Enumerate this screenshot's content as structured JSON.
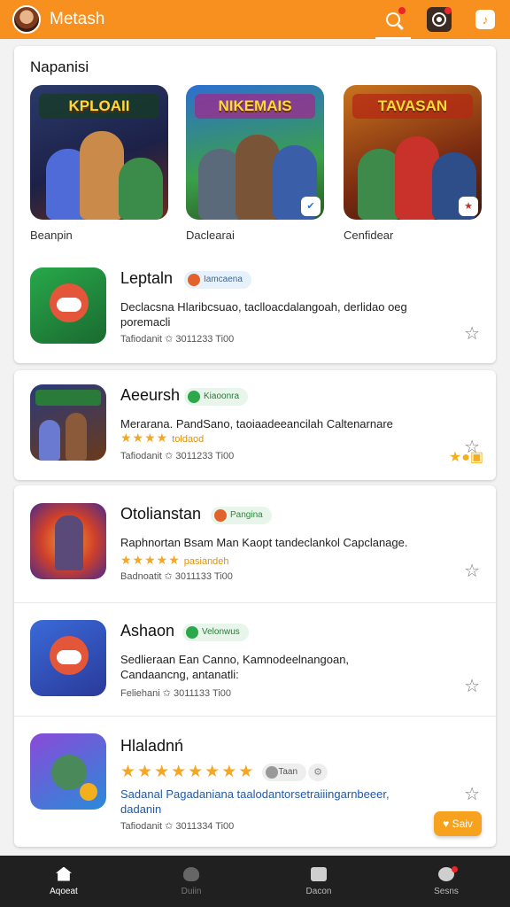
{
  "header": {
    "title": "Mеtаsh",
    "accent": "#f7901e"
  },
  "featured": {
    "section_title": "Napanisi",
    "items": [
      {
        "banner": "KPLOAII",
        "label": "Beanpin"
      },
      {
        "banner": "NIKEMAIS",
        "label": "Daclearai"
      },
      {
        "banner": "TAVASAN",
        "label": "Cenfidear"
      }
    ]
  },
  "apps": [
    {
      "title": "Leptaln",
      "tag": "Iamcaena",
      "desc": "Declacsna Hlaribcsuao, taclloacdalangoah, derlidao oeg poremacli",
      "rating_label": "",
      "meta": "Tafiodanit   ✩ 3011233 Ti00",
      "tag_color": "#e2622b"
    },
    {
      "title": "Aeeursh",
      "tag": "Kiaoonra",
      "desc": "Merarana. PandSano, taoiaadeeancilah Caltenarnare",
      "rating_label": "toldaod",
      "meta": "Tafiodanit   ✩ 3011233 Ti00",
      "tag_color": "#2aa84a"
    },
    {
      "title": "Otolianstan",
      "tag": "Pangina",
      "desc": "Raphnortan Bsam Man Kaopt tandeclankol Capclanage.",
      "rating_label": "pasiandeh",
      "meta": "Badnoatit   ✩ 3011133 Ti00",
      "tag_color": "#e2622b"
    },
    {
      "title": "Ashaon",
      "tag": "Velonwus",
      "desc": "Sedlieraan Ean Canno, Kamnodeelnangoan, Candaancng, antanatli:",
      "rating_label": "",
      "meta": "Feliehani   ✩ 3011133 Ti00",
      "tag_color": "#2aa84a"
    },
    {
      "title": "Hlaladnń",
      "tag": "3.Taan",
      "desc": "Sadanal Pagadaniana taalodantorsetraiiingarnbeeer, dadanin",
      "rating_label": "",
      "meta": "Tafiodanit   ✩ 3011334 Ti00",
      "tag_color": "#777777"
    }
  ],
  "save_button": "Saiv",
  "nav": [
    {
      "label": "Aqoeat"
    },
    {
      "label": "Duiin"
    },
    {
      "label": "Dacon"
    },
    {
      "label": "Sesns"
    }
  ]
}
